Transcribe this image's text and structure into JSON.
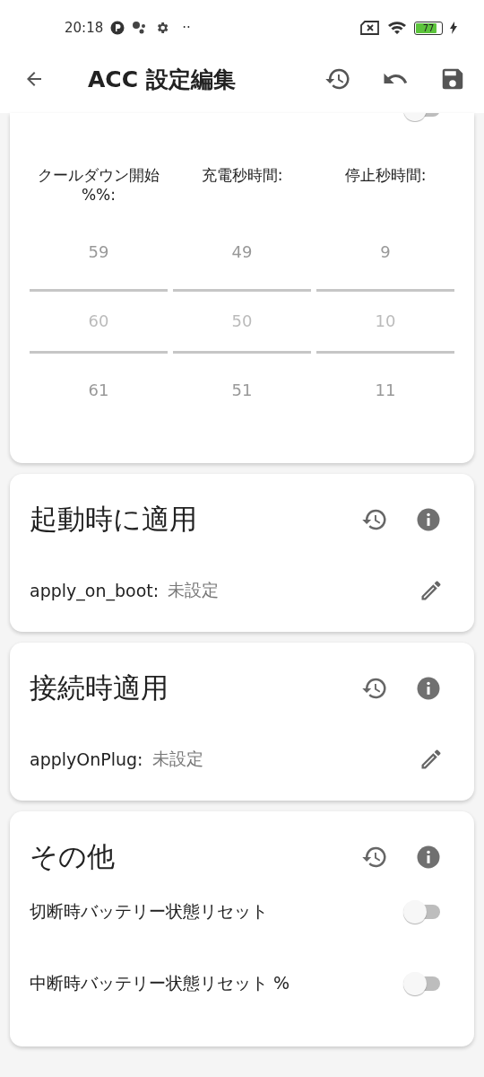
{
  "status_bar": {
    "time": "20:18",
    "more": "··",
    "battery": "77"
  },
  "app_bar": {
    "title": "ACC 設定編集"
  },
  "cards": [
    {
      "kind": "pickers",
      "toggle": {
        "on": false
      },
      "columns": [
        {
          "label": "クールダウン開始 %%:",
          "values": [
            {
              "text": "59",
              "selected": false
            },
            {
              "text": "60",
              "selected": true
            },
            {
              "text": "61",
              "selected": false
            }
          ]
        },
        {
          "label": "充電秒時間:",
          "values": [
            {
              "text": "49",
              "selected": false
            },
            {
              "text": "50",
              "selected": true
            },
            {
              "text": "51",
              "selected": false
            }
          ]
        },
        {
          "label": "停止秒時間:",
          "values": [
            {
              "text": "9",
              "selected": false
            },
            {
              "text": "10",
              "selected": true
            },
            {
              "text": "11",
              "selected": false
            }
          ]
        }
      ]
    },
    {
      "kind": "field",
      "title": "起動時に適用",
      "field": {
        "key": "apply_on_boot:",
        "value": "未設定"
      }
    },
    {
      "kind": "field",
      "title": "接続時適用",
      "field": {
        "key": "applyOnPlug:",
        "value": "未設定"
      }
    },
    {
      "kind": "toggles",
      "title": "その他",
      "toggles": [
        {
          "label": "切断時バッテリー状態リセット",
          "on": false
        },
        {
          "label": "中断時バッテリー状態リセット %",
          "on": false
        }
      ]
    }
  ]
}
